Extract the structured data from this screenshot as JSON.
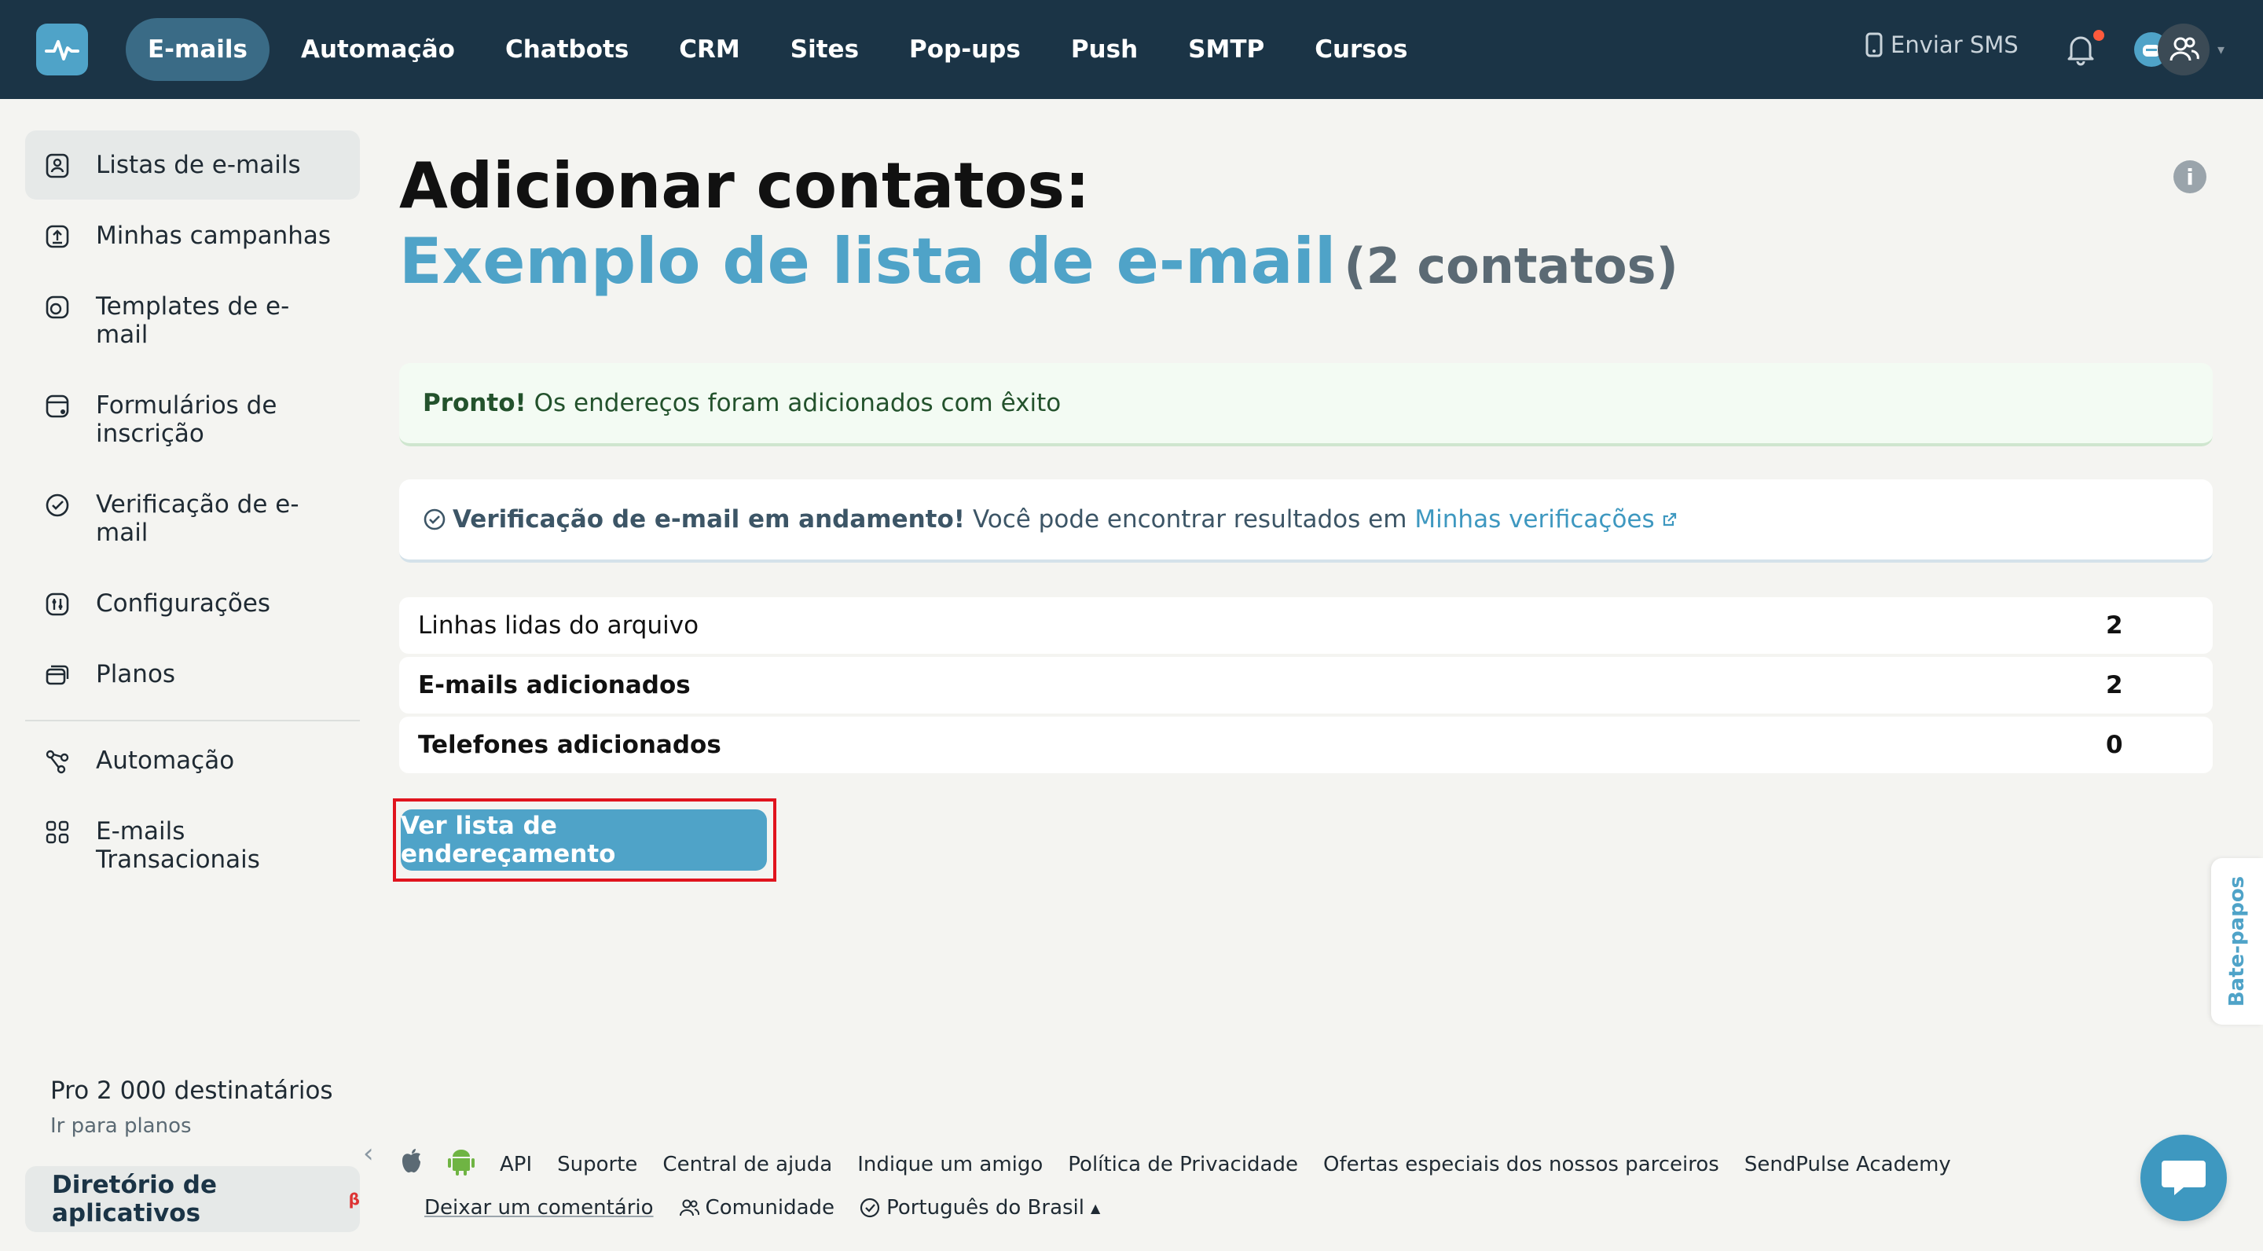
{
  "topbar": {
    "nav": [
      "E-mails",
      "Automação",
      "Chatbots",
      "CRM",
      "Sites",
      "Pop-ups",
      "Push",
      "SMTP",
      "Cursos"
    ],
    "active_nav": "E-mails",
    "sms_label": "Enviar SMS"
  },
  "sidebar": {
    "items": [
      {
        "label": "Listas de e-mails",
        "icon": "contacts-list-icon"
      },
      {
        "label": "Minhas campanhas",
        "icon": "campaign-upload-icon"
      },
      {
        "label": "Templates de e-mail",
        "icon": "template-icon"
      },
      {
        "label": "Formulários de inscrição",
        "icon": "form-icon"
      },
      {
        "label": "Verificação de e-mail",
        "icon": "check-circle-icon"
      },
      {
        "label": "Configurações",
        "icon": "settings-icon"
      },
      {
        "label": "Planos",
        "icon": "card-icon"
      },
      {
        "label": "Automação",
        "icon": "automation-icon"
      },
      {
        "label": "E-mails Transacionais",
        "icon": "grid-icon"
      }
    ],
    "plan_title": "Pro 2 000 destinatários",
    "plan_link": "Ir para planos",
    "directory_label": "Diretório de aplicativos",
    "directory_badge": "β"
  },
  "main": {
    "title": "Adicionar contatos:",
    "list_name": "Exemplo de lista de e-mail",
    "count": "(2 contatos)",
    "alert_ok_strong": "Pronto!",
    "alert_ok_text": "Os endereços foram adicionados com êxito",
    "alert_info_strong": "Verificação de e-mail em andamento!",
    "alert_info_text": "Você pode encontrar resultados em",
    "alert_info_link": "Minhas verificações",
    "stats": [
      {
        "label": "Linhas lidas do arquivo",
        "value": "2"
      },
      {
        "label": "E-mails adicionados",
        "value": "2"
      },
      {
        "label": "Telefones adicionados",
        "value": "0"
      }
    ],
    "view_button": "Ver lista de endereçamento"
  },
  "footer": {
    "links": [
      "API",
      "Suporte",
      "Central de ajuda",
      "Indique um amigo",
      "Política de Privacidade",
      "Ofertas especiais dos nossos parceiros",
      "SendPulse Academy"
    ],
    "comment": "Deixar um comentário",
    "community": "Comunidade",
    "language": "Português do Brasil"
  },
  "chats_tab": "Bate-papos",
  "colors": {
    "topbar": "#1b3446",
    "accent": "#4fa3c8",
    "success_bg": "#f3fbf3",
    "highlight": "#e0141e"
  }
}
